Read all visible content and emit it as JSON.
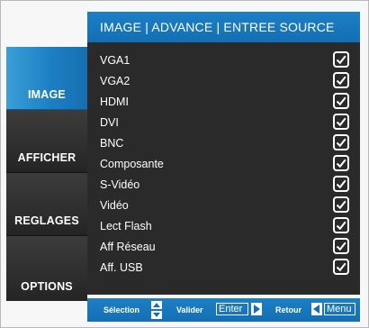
{
  "header": {
    "title": "IMAGE | ADVANCE | ENTREE SOURCE"
  },
  "tabs": [
    {
      "label": "IMAGE",
      "active": true
    },
    {
      "label": "AFFICHER",
      "active": false
    },
    {
      "label": "REGLAGES",
      "active": false
    },
    {
      "label": "OPTIONS",
      "active": false
    }
  ],
  "sources": [
    {
      "label": "VGA1",
      "checked": true
    },
    {
      "label": "VGA2",
      "checked": true
    },
    {
      "label": "HDMI",
      "checked": true
    },
    {
      "label": "DVI",
      "checked": true
    },
    {
      "label": "BNC",
      "checked": true
    },
    {
      "label": "Composante",
      "checked": true
    },
    {
      "label": "S-Vidéo",
      "checked": true
    },
    {
      "label": "Vidéo",
      "checked": true
    },
    {
      "label": "Lect Flash",
      "checked": true
    },
    {
      "label": "Aff Réseau",
      "checked": true
    },
    {
      "label": "Aff. USB",
      "checked": true
    }
  ],
  "footer": {
    "selection_label": "Sélection",
    "valider_label": "Valider",
    "enter_key": "Enter",
    "retour_label": "Retour",
    "menu_key": "Menu"
  },
  "colors": {
    "accent": "#1b7cc0",
    "panel": "#2a2a2a",
    "text": "#ffffff"
  }
}
